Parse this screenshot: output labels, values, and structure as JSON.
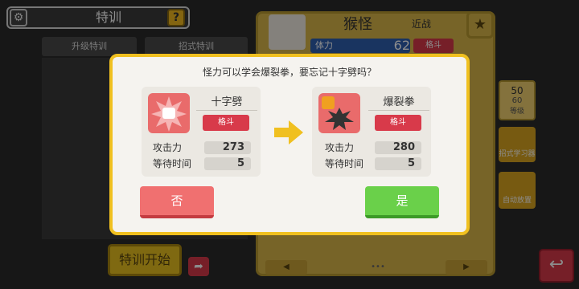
{
  "header": {
    "title": "特训",
    "help_label": "?",
    "settings_icon": "gear-icon"
  },
  "tabs": [
    {
      "label": "升级特训"
    },
    {
      "label": "招式特训"
    }
  ],
  "monster": {
    "name": "猴怪",
    "role": "近战",
    "hp_label": "体力",
    "hp_value": "62",
    "type": "格斗"
  },
  "side": {
    "level_current": "50",
    "level_max": "60",
    "level_label": "等级",
    "learner_label": "招式学习器",
    "auto_label": "自动放置"
  },
  "bottom": {
    "start_label": "特训开始",
    "dots": "•••"
  },
  "colors": {
    "accent": "#f0c020",
    "type_fighting": "#d83a4a",
    "yes": "#6ad04a",
    "no": "#f07070"
  },
  "dialog": {
    "question": "怪力可以学会爆裂拳，要忘记十字劈吗？",
    "old_move": {
      "name": "十字劈",
      "type": "格斗",
      "attack_label": "攻击力",
      "attack": "273",
      "wait_label": "等待时间",
      "wait": "5"
    },
    "new_move": {
      "name": "爆裂拳",
      "type": "格斗",
      "attack_label": "攻击力",
      "attack": "280",
      "wait_label": "等待时间",
      "wait": "5"
    },
    "no_label": "否",
    "yes_label": "是"
  }
}
